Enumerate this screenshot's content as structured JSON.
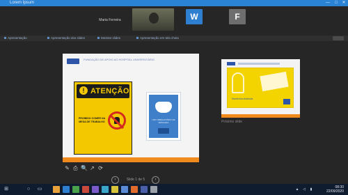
{
  "window": {
    "title": "Lorem Ipsum",
    "controls": {
      "minimize": "—",
      "maximize": "□",
      "close": "✕"
    },
    "accent": "#2b83d6"
  },
  "participants": [
    {
      "name": "Maria Ferreira",
      "type": "name-only"
    },
    {
      "name": "",
      "type": "video"
    },
    {
      "name": "",
      "type": "avatar",
      "initial": "W",
      "color": "#2f7fd0"
    },
    {
      "name": "",
      "type": "avatar",
      "initial": "F",
      "color": "#6e6e6e"
    }
  ],
  "share_strip": {
    "tabs": [
      "Apresentação",
      "Apresentação dos slides",
      "Mostrar slides",
      "Apresentação em tela cheia"
    ]
  },
  "slide_main": {
    "header": "FUNDAÇÃO DE APOIO AO HOSPITAL UNIVERSITÁRIO",
    "warning": {
      "icon": "!",
      "title": "ATENÇÃO",
      "text": "PROIBIDO COMER NA MESA DE TRABALHO"
    },
    "mask_sign": {
      "caption": "USO OBRIGATÓRIO DE MÁSCARA"
    },
    "colors": {
      "sign_yellow": "#f4c800",
      "mask_blue": "#3f7ec9",
      "footer_orange": "#f08a1c"
    }
  },
  "slide_tools": [
    "✎",
    "⎙",
    "🔍",
    "↗",
    "⟳"
  ],
  "pager": {
    "prev": "‹",
    "next": "›",
    "text": "Slide 1 de 5"
  },
  "slide_next": {
    "text": "Mantenha distância",
    "label": "Próximo slide"
  },
  "taskbar": {
    "icons": [
      "start-icon",
      "search-icon",
      "task-view-icon"
    ],
    "apps": [
      "#e8a13b",
      "#2f7fd0",
      "#4aa34a",
      "#c94a3b",
      "#7a5bc9",
      "#3aa6c9",
      "#d6c53a",
      "#5b8bd6",
      "#e06b2c",
      "#4b5fa8",
      "#9aa1aa"
    ],
    "tray": {
      "time": "08:30",
      "date": "22/09/2020"
    }
  }
}
